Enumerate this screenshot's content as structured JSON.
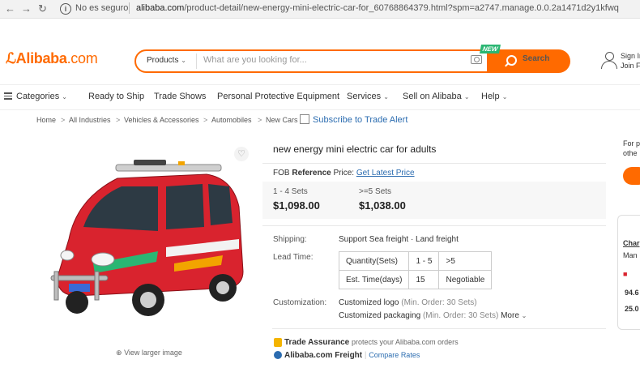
{
  "browser": {
    "back_icon": "arrow-left-icon",
    "forward_icon": "arrow-right-icon",
    "reload_icon": "reload-icon",
    "not_secure": "No es seguro",
    "url_domain": "alibaba.com",
    "url_path": "/product-detail/new-energy-mini-electric-car-for_60768864379.html?spm=a2747.manage.0.0.2a1471d2y1kfwq"
  },
  "header": {
    "logo_main": "Alibaba",
    "logo_suffix": ".com",
    "search_category": "Products",
    "search_placeholder": "What are you looking for...",
    "search_button": "Search",
    "new_badge": "NEW",
    "signin_line1": "Sign In",
    "signin_line2": "Join Free"
  },
  "nav": {
    "categories": "Categories",
    "items": [
      "Ready to Ship",
      "Trade Shows",
      "Personal Protective Equipment",
      "Services",
      "Sell on Alibaba",
      "Help"
    ]
  },
  "breadcrumb": {
    "items": [
      "Home",
      "All Industries",
      "Vehicles & Accessories",
      "Automobiles",
      "New Cars"
    ],
    "separator": ">",
    "subscribe": "Subscribe to Trade Alert"
  },
  "gallery": {
    "view_larger": "View larger image",
    "brand_colors": {
      "car": "#d9232e",
      "accent": "#ff6a00"
    }
  },
  "product": {
    "title": "new energy mini electric car for adults",
    "fob_prefix": "FOB",
    "fob_bold": "Reference",
    "fob_suffix": "Price:",
    "fob_link": "Get Latest Price",
    "tiers": [
      {
        "qty": "1 - 4 Sets",
        "price": "$1,098.00"
      },
      {
        "qty": ">=5 Sets",
        "price": "$1,038.00"
      }
    ],
    "shipping_label": "Shipping:",
    "shipping_value": "Support Sea freight · Land freight",
    "lead_label": "Lead Time:",
    "lead_table": {
      "row1": [
        "Quantity(Sets)",
        "1 - 5",
        ">5"
      ],
      "row2": [
        "Est. Time(days)",
        "15",
        "Negotiable"
      ]
    },
    "custom_label": "Customization:",
    "custom_logo": "Customized logo",
    "custom_logo_min": "(Min. Order: 30 Sets)",
    "custom_pack": "Customized packaging",
    "custom_pack_min": "(Min. Order: 30 Sets)",
    "more": "More",
    "trade_assurance": "Trade Assurance",
    "trade_assurance_desc": "protects your Alibaba.com orders",
    "freight": "Alibaba.com Freight",
    "compare_rates": "Compare Rates"
  },
  "side": {
    "line1": "For p",
    "line2": "othe",
    "company": "Char",
    "company2": "Man",
    "stat1": "94.6",
    "stat2": "25.0"
  }
}
